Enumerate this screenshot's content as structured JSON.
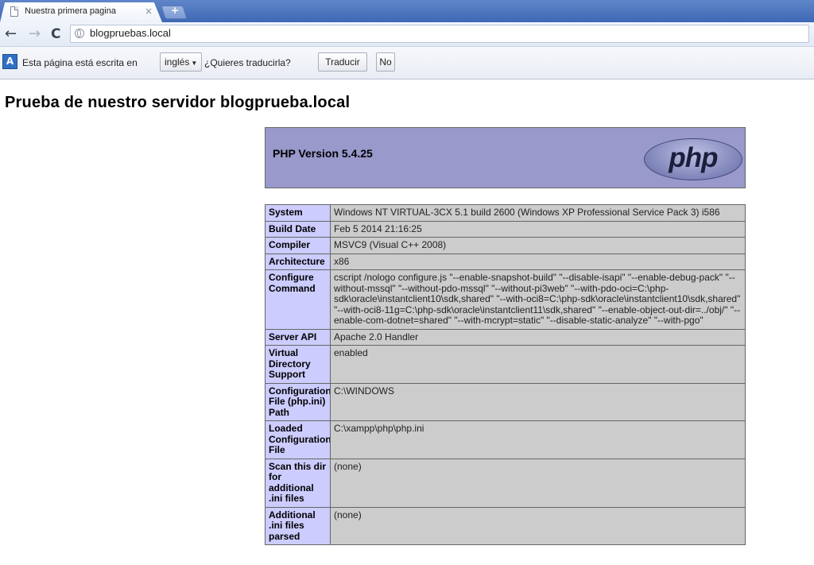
{
  "browser": {
    "tab": {
      "title": "Nuestra primera pagina",
      "close_glyph": "×",
      "new_tab_glyph": "+"
    },
    "url": "blogpruebas.local",
    "nav": {
      "back_glyph": "←",
      "forward_glyph": "→",
      "reload_glyph": "C"
    }
  },
  "infobar": {
    "icon": "translate-icon",
    "icon_glyph": "A",
    "message": "Esta página está escrita en",
    "language": "inglés",
    "question": "¿Quieres traducirla?",
    "translate_label": "Traducir",
    "no_label": "No"
  },
  "page": {
    "heading": "Prueba de nuestro servidor blogprueba.local",
    "php_version": "PHP Version 5.4.25",
    "php_logo_text": "php",
    "colors": {
      "header_bg": "#9999cc",
      "key_bg": "#ccccff",
      "value_bg": "#cccccc"
    },
    "rows": [
      {
        "key": "System",
        "value": "Windows NT VIRTUAL-3CX 5.1 build 2600 (Windows XP Professional Service Pack 3) i586"
      },
      {
        "key": "Build Date",
        "value": "Feb 5 2014 21:16:25"
      },
      {
        "key": "Compiler",
        "value": "MSVC9 (Visual C++ 2008)"
      },
      {
        "key": "Architecture",
        "value": "x86"
      },
      {
        "key": "Configure Command",
        "value": "cscript /nologo configure.js \"--enable-snapshot-build\" \"--disable-isapi\" \"--enable-debug-pack\" \"--without-mssql\" \"--without-pdo-mssql\" \"--without-pi3web\" \"--with-pdo-oci=C:\\php-sdk\\oracle\\instantclient10\\sdk,shared\" \"--with-oci8=C:\\php-sdk\\oracle\\instantclient10\\sdk,shared\" \"--with-oci8-11g=C:\\php-sdk\\oracle\\instantclient11\\sdk,shared\" \"--enable-object-out-dir=../obj/\" \"--enable-com-dotnet=shared\" \"--with-mcrypt=static\" \"--disable-static-analyze\" \"--with-pgo\""
      },
      {
        "key": "Server API",
        "value": "Apache 2.0 Handler"
      },
      {
        "key": "Virtual Directory Support",
        "value": "enabled"
      },
      {
        "key": "Configuration File (php.ini) Path",
        "value": "C:\\WINDOWS"
      },
      {
        "key": "Loaded Configuration File",
        "value": "C:\\xampp\\php\\php.ini"
      },
      {
        "key": "Scan this dir for additional .ini files",
        "value": "(none)"
      },
      {
        "key": "Additional .ini files parsed",
        "value": "(none)"
      }
    ]
  }
}
